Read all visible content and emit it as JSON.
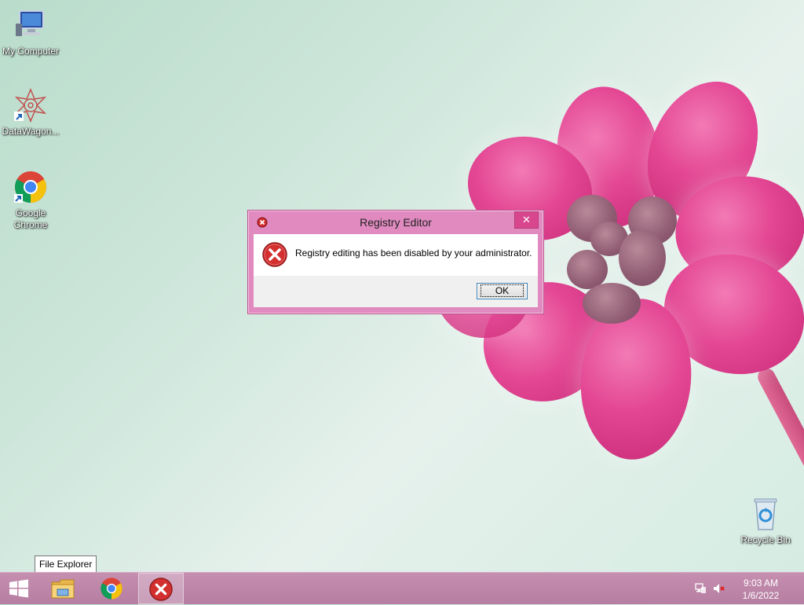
{
  "desktop": {
    "icons": [
      {
        "name": "my-computer",
        "label": "My Computer"
      },
      {
        "name": "datawagon",
        "label": "DataWagon..."
      },
      {
        "name": "google-chrome",
        "label": "Google Chrome"
      },
      {
        "name": "recycle-bin",
        "label": "Recycle Bin"
      }
    ]
  },
  "dialog": {
    "title": "Registry Editor",
    "close_glyph": "✕",
    "message": "Registry editing has been disabled by your administrator.",
    "ok_label": "OK",
    "icon": "error-icon"
  },
  "tooltip": {
    "text": "File Explorer"
  },
  "taskbar": {
    "items": [
      "windows-start-icon",
      "file-explorer-icon",
      "chrome-icon",
      "error-app-icon"
    ],
    "tray_icons": [
      "network-icon",
      "volume-muted-icon"
    ],
    "time": "9:03 AM",
    "date": "1/6/2022"
  },
  "colors": {
    "taskbar": "#b67ea2",
    "dialog_frame": "#e08ac0",
    "close_button": "#d8468e",
    "error_red": "#d32f2f"
  }
}
